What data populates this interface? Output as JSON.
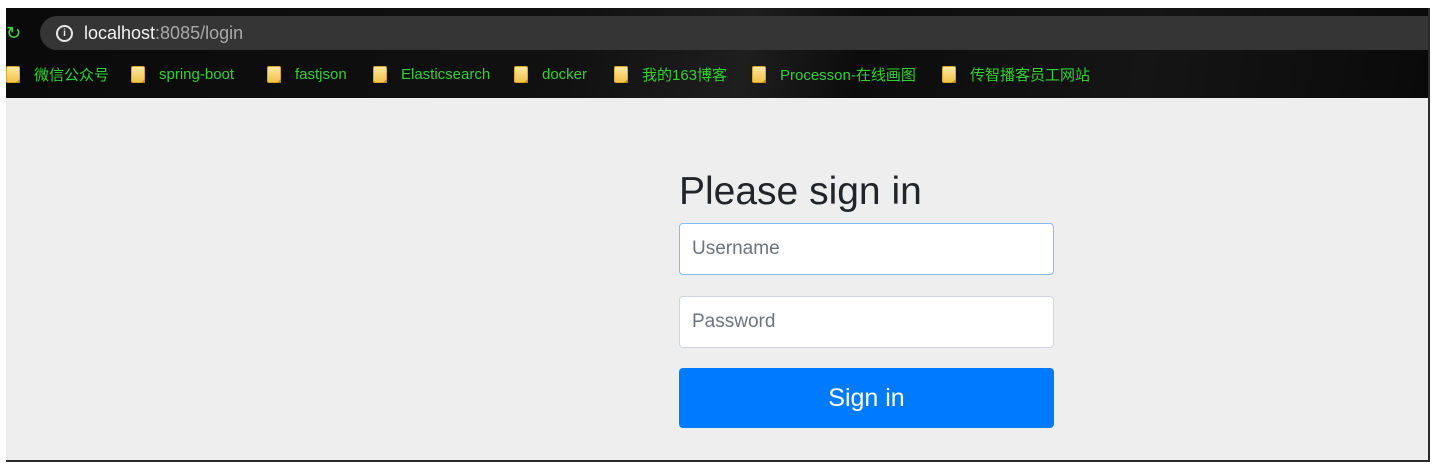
{
  "browser": {
    "url_host": "localhost",
    "url_path": ":8085/login",
    "bookmarks": [
      {
        "label": "微信公众号"
      },
      {
        "label": "spring-boot"
      },
      {
        "label": "fastjson"
      },
      {
        "label": "Elasticsearch"
      },
      {
        "label": "docker"
      },
      {
        "label": "我的163博客"
      },
      {
        "label": "Processon-在线画图"
      },
      {
        "label": "传智播客员工网站"
      }
    ]
  },
  "form": {
    "heading": "Please sign in",
    "username_placeholder": "Username",
    "password_placeholder": "Password",
    "submit_label": "Sign in"
  },
  "colors": {
    "bookmark_text": "#31d131",
    "primary_button": "#007bff",
    "page_background": "#eeeeee"
  }
}
